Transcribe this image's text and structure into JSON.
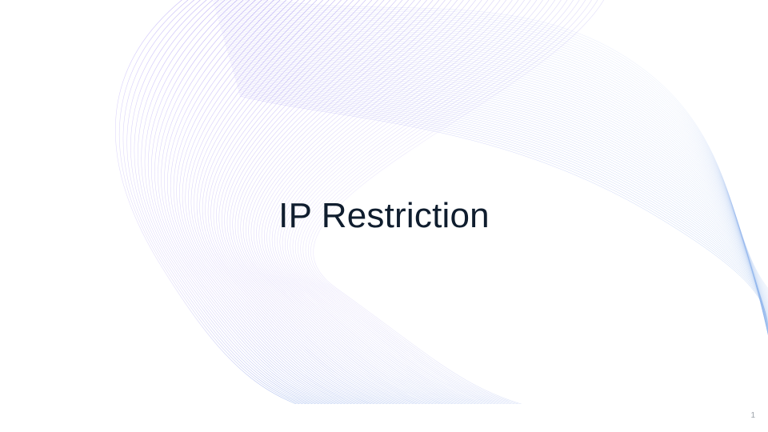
{
  "slide": {
    "title": "IP Restriction",
    "page_number": "1"
  },
  "theme": {
    "background": "#ffffff",
    "title_color": "#0f1d2e",
    "wave_colors": [
      "#7b61ff",
      "#a99cf2",
      "#8fb4ea"
    ],
    "background_graphic": "flowing-wave-lines"
  }
}
